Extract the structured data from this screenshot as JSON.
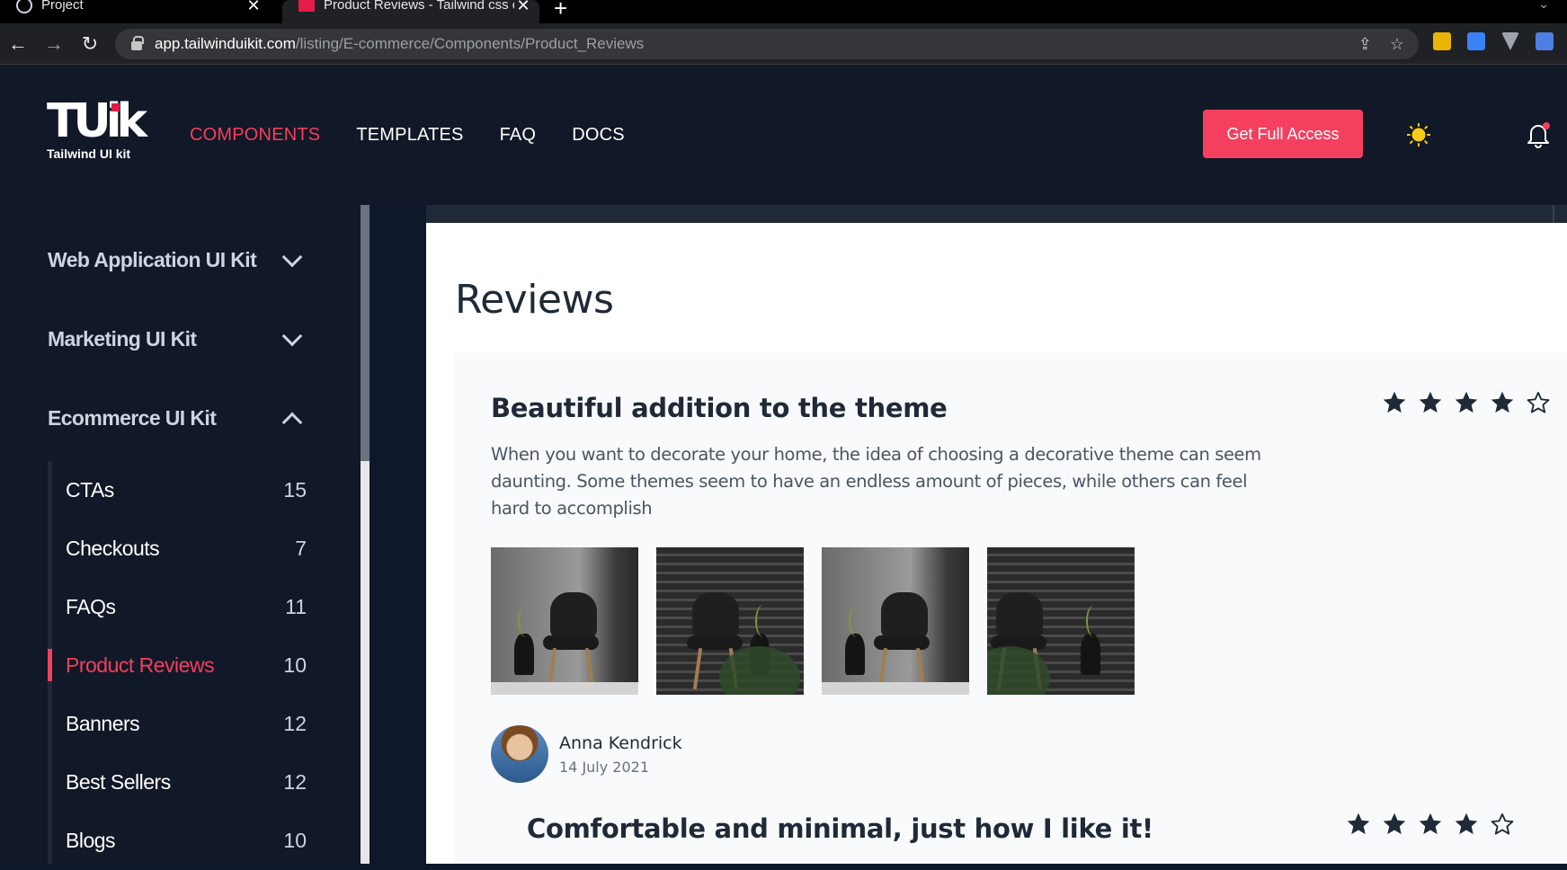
{
  "browser": {
    "tabs": [
      {
        "title": "Project",
        "active": false
      },
      {
        "title": "Product Reviews - Tailwind css co",
        "active": true
      }
    ],
    "url_host": "app.tailwinduikit.com",
    "url_path": "/listing/E-commerce/Components/Product_Reviews"
  },
  "header": {
    "logo_mark": "TUik",
    "logo_sub": "Tailwind UI kit",
    "nav": [
      {
        "label": "COMPONENTS",
        "active": true
      },
      {
        "label": "TEMPLATES",
        "active": false
      },
      {
        "label": "FAQ",
        "active": false
      },
      {
        "label": "DOCS",
        "active": false
      }
    ],
    "cta_label": "Get Full Access",
    "accent": "#f43f5e"
  },
  "sidebar": {
    "kits": [
      {
        "label": "Web Application UI Kit",
        "expanded": false
      },
      {
        "label": "Marketing UI Kit",
        "expanded": false
      },
      {
        "label": "Ecommerce UI Kit",
        "expanded": true
      }
    ],
    "items": [
      {
        "label": "CTAs",
        "count": "15",
        "active": false
      },
      {
        "label": "Checkouts",
        "count": "7",
        "active": false
      },
      {
        "label": "FAQs",
        "count": "11",
        "active": false
      },
      {
        "label": "Product Reviews",
        "count": "10",
        "active": true
      },
      {
        "label": "Banners",
        "count": "12",
        "active": false
      },
      {
        "label": "Best Sellers",
        "count": "12",
        "active": false
      },
      {
        "label": "Blogs",
        "count": "10",
        "active": false
      }
    ]
  },
  "main": {
    "title": "Reviews",
    "reviews": [
      {
        "title": "Beautiful addition to the theme",
        "rating": 4,
        "max_rating": 5,
        "body": "When you want to decorate your home, the idea of choosing a decorative theme can seem daunting. Some themes seem to have an endless amount of pieces, while others can feel hard to accomplish",
        "author": "Anna Kendrick",
        "date": "14 July 2021"
      },
      {
        "title": "Comfortable and minimal, just how I like it!",
        "rating": 4,
        "max_rating": 5
      }
    ]
  }
}
